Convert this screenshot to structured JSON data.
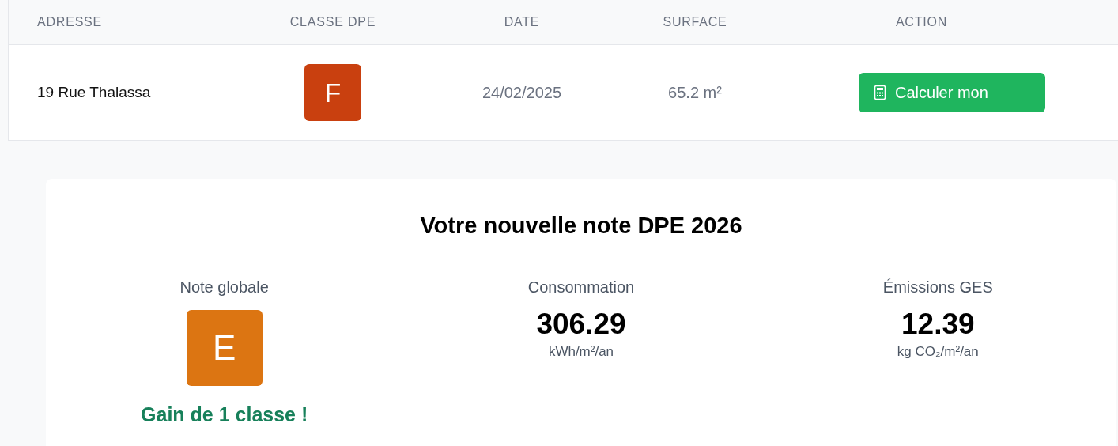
{
  "table": {
    "columns": [
      "ADRESSE",
      "CLASSE DPE",
      "DATE",
      "SURFACE",
      "ACTION"
    ],
    "rows": [
      {
        "address": "19 Rue Thalassa",
        "dpe_class": {
          "label": "F",
          "color": "#c9400f"
        },
        "date": "24/02/2025",
        "surface": "65.2 m²",
        "action": "Calculer mon"
      }
    ]
  },
  "result": {
    "title": "Votre nouvelle note DPE 2026",
    "metrics": [
      {
        "kind": "grade",
        "label": "Note globale",
        "grade": "E",
        "color": "#dc7512",
        "note": "Gain de 1 classe !"
      },
      {
        "kind": "value",
        "label": "Consommation",
        "value": "306.29",
        "unit": "kWh/m²/an"
      },
      {
        "kind": "value",
        "label": "Émissions GES",
        "value": "12.39",
        "unit": "kg CO₂/m²/an"
      }
    ]
  }
}
